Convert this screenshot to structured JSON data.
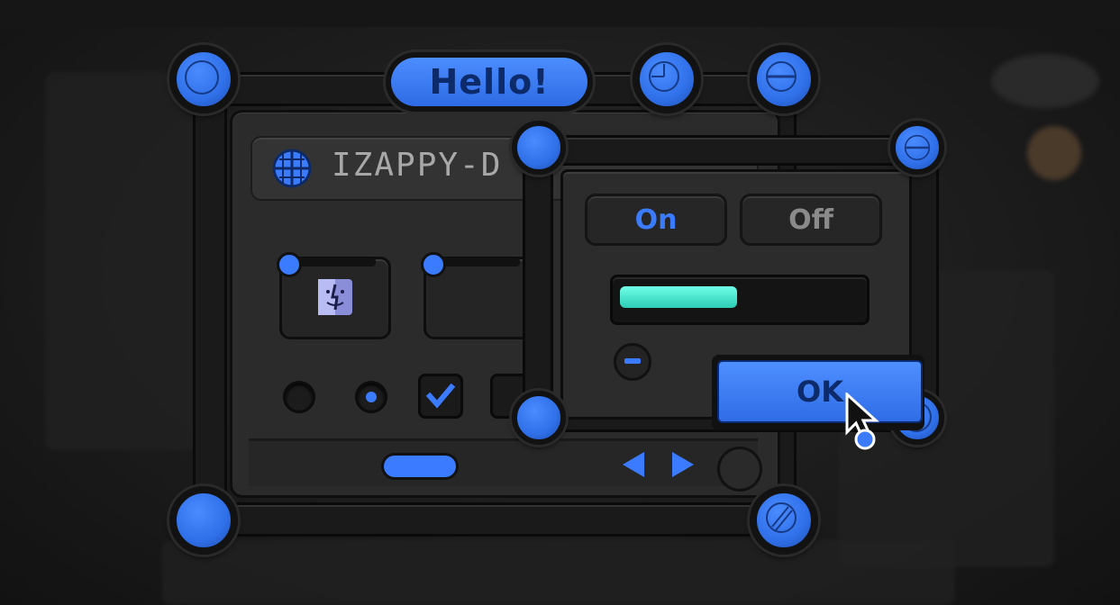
{
  "colors": {
    "accent": "#3a7bff",
    "accent_dark": "#0d2a6a",
    "progress": "#3ee0c8",
    "muted_text": "#a8a8a8"
  },
  "badge": {
    "label": "Hello!"
  },
  "window": {
    "title": "IZAPPY-D"
  },
  "toggle": {
    "on_label": "On",
    "off_label": "Off",
    "selected": "On"
  },
  "progress": {
    "fraction": 0.5
  },
  "dialog": {
    "ok_label": "OK"
  },
  "icons": [
    "globe-icon",
    "clock-icon",
    "minus-circle-icon",
    "slash-circle-icon",
    "finder-icon",
    "check-icon",
    "left-arrow-icon",
    "right-arrow-icon",
    "pointer-cursor-icon"
  ]
}
